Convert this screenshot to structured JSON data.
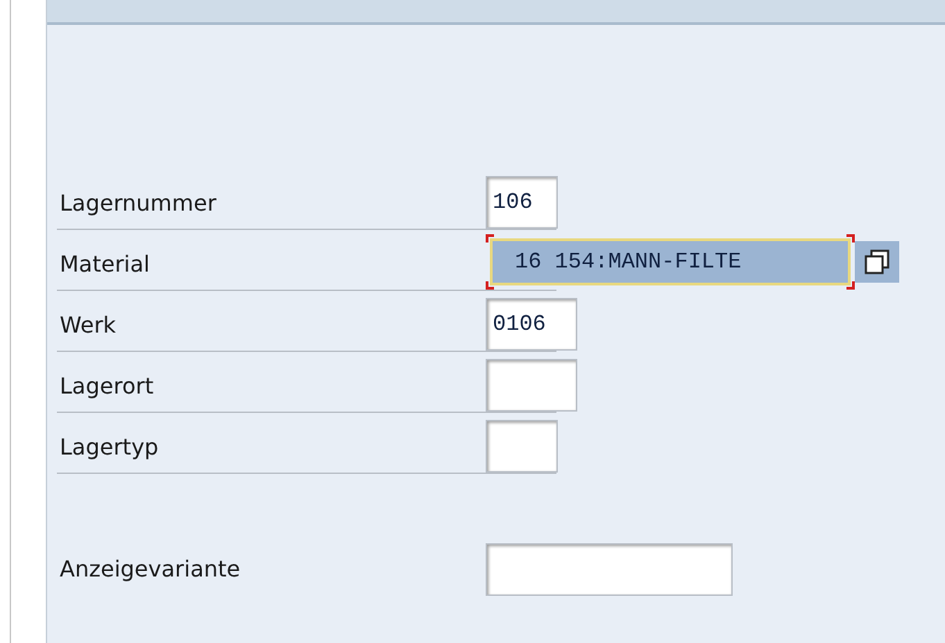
{
  "fields": [
    {
      "label": "Lagernummer",
      "value": "106",
      "focused": false
    },
    {
      "label": "Material",
      "value": "16 154:MANN-FILTE",
      "focused": true,
      "has_value_help": true
    },
    {
      "label": "Werk",
      "value": "0106",
      "focused": false
    },
    {
      "label": "Lagerort",
      "focused": false
    },
    {
      "label": "Lagertyp",
      "focused": false
    }
  ],
  "display_variant": {
    "label": "Anzeigevariante"
  }
}
